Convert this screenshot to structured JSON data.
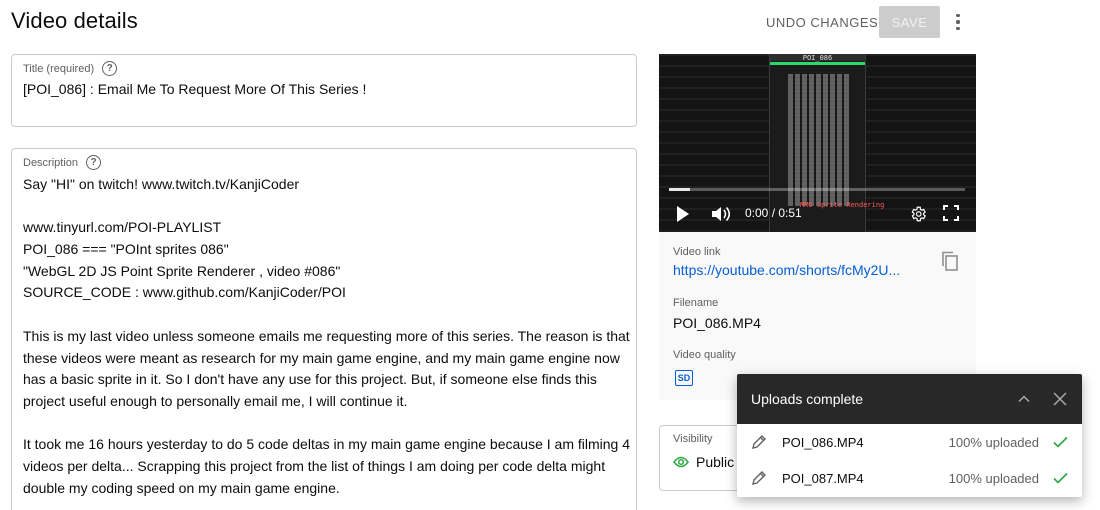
{
  "header": {
    "title": "Video details",
    "undo_label": "UNDO CHANGES",
    "save_label": "SAVE"
  },
  "title_field": {
    "label": "Title (required)",
    "value": "[POI_086] : Email Me To Request More Of This Series !"
  },
  "description": {
    "label": "Description",
    "lines": [
      "Say \"HI\" on twitch! www.twitch.tv/KanjiCoder",
      "",
      "www.tinyurl.com/POI-PLAYLIST",
      "POI_086 === \"POInt sprites 086\"",
      "\"WebGL 2D JS Point Sprite Renderer , video #086\"",
      "SOURCE_CODE : www.github.com/KanjiCoder/POI",
      "",
      "This is my last video unless someone emails me requesting more of this series. The reason is that",
      "these videos were meant as research for my main game engine, and my main game engine now",
      "has a basic sprite in it. So I don't have any use for this project. But, if someone else finds this",
      "project useful enough to personally email me, I will continue it.",
      "",
      "It took me 16 hours yesterday to do 5 code deltas in my main game engine because I am filming 4",
      "videos per delta... Scrapping this project from the list of things I am doing per code delta might",
      "double my coding speed on my main game engine."
    ]
  },
  "player": {
    "time": "0:00 / 0:51",
    "progress": 0.07,
    "frame_title": "POI_086",
    "frame_caption": "MMO Sprite Rendering"
  },
  "info": {
    "video_link_label": "Video link",
    "video_link": "https://youtube.com/shorts/fcMy2U...",
    "filename_label": "Filename",
    "filename": "POI_086.MP4",
    "quality_label": "Video quality",
    "quality_badge": "SD"
  },
  "visibility": {
    "label": "Visibility",
    "value": "Public"
  },
  "uploads": {
    "title": "Uploads complete",
    "items": [
      {
        "name": "POI_086.MP4",
        "status": "100% uploaded"
      },
      {
        "name": "POI_087.MP4",
        "status": "100% uploaded"
      }
    ]
  },
  "colors": {
    "accent_blue": "#065fd4",
    "success_green": "#2ba640",
    "popup_header": "#282828"
  },
  "icons": [
    "help-icon",
    "more-vert-icon",
    "play-icon",
    "volume-icon",
    "gear-icon",
    "fullscreen-icon",
    "copy-icon",
    "sd-icon",
    "eye-icon",
    "chevron-up-icon",
    "close-icon",
    "pencil-icon",
    "check-icon"
  ]
}
